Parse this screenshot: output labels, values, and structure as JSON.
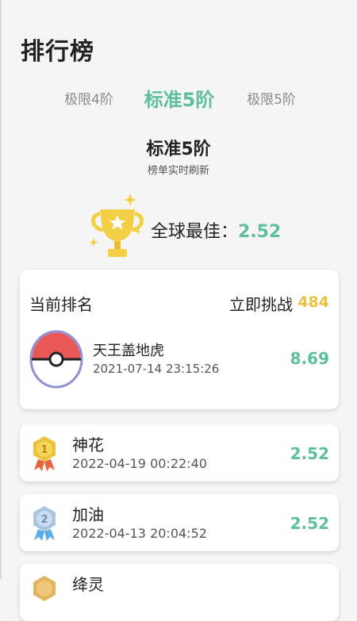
{
  "header": {
    "title": "排行榜"
  },
  "tabs": [
    {
      "label": "极限4阶",
      "active": false
    },
    {
      "label": "标准5阶",
      "active": true
    },
    {
      "label": "极限5阶",
      "active": false
    }
  ],
  "mode": {
    "title": "标准5阶",
    "subtitle": "榜单实时刷新"
  },
  "best": {
    "label": "全球最佳：",
    "value": "2.52"
  },
  "current": {
    "label": "当前排名",
    "challenge_label": "立即挑战",
    "challenge_count": "484",
    "name": "天王盖地虎",
    "time": "2021-07-14 23:15:26",
    "score": "8.69"
  },
  "ranking": [
    {
      "rank": "1",
      "name": "神花",
      "time": "2022-04-19 00:22:40",
      "score": "2.52"
    },
    {
      "rank": "2",
      "name": "加油",
      "time": "2022-04-13 20:04:52",
      "score": "2.52"
    },
    {
      "rank": "3",
      "name": "绛灵",
      "time": "",
      "score": ""
    }
  ],
  "colors": {
    "accent": "#5dbf9c",
    "gold": "#e8c341",
    "silver": "#a9c4de"
  }
}
